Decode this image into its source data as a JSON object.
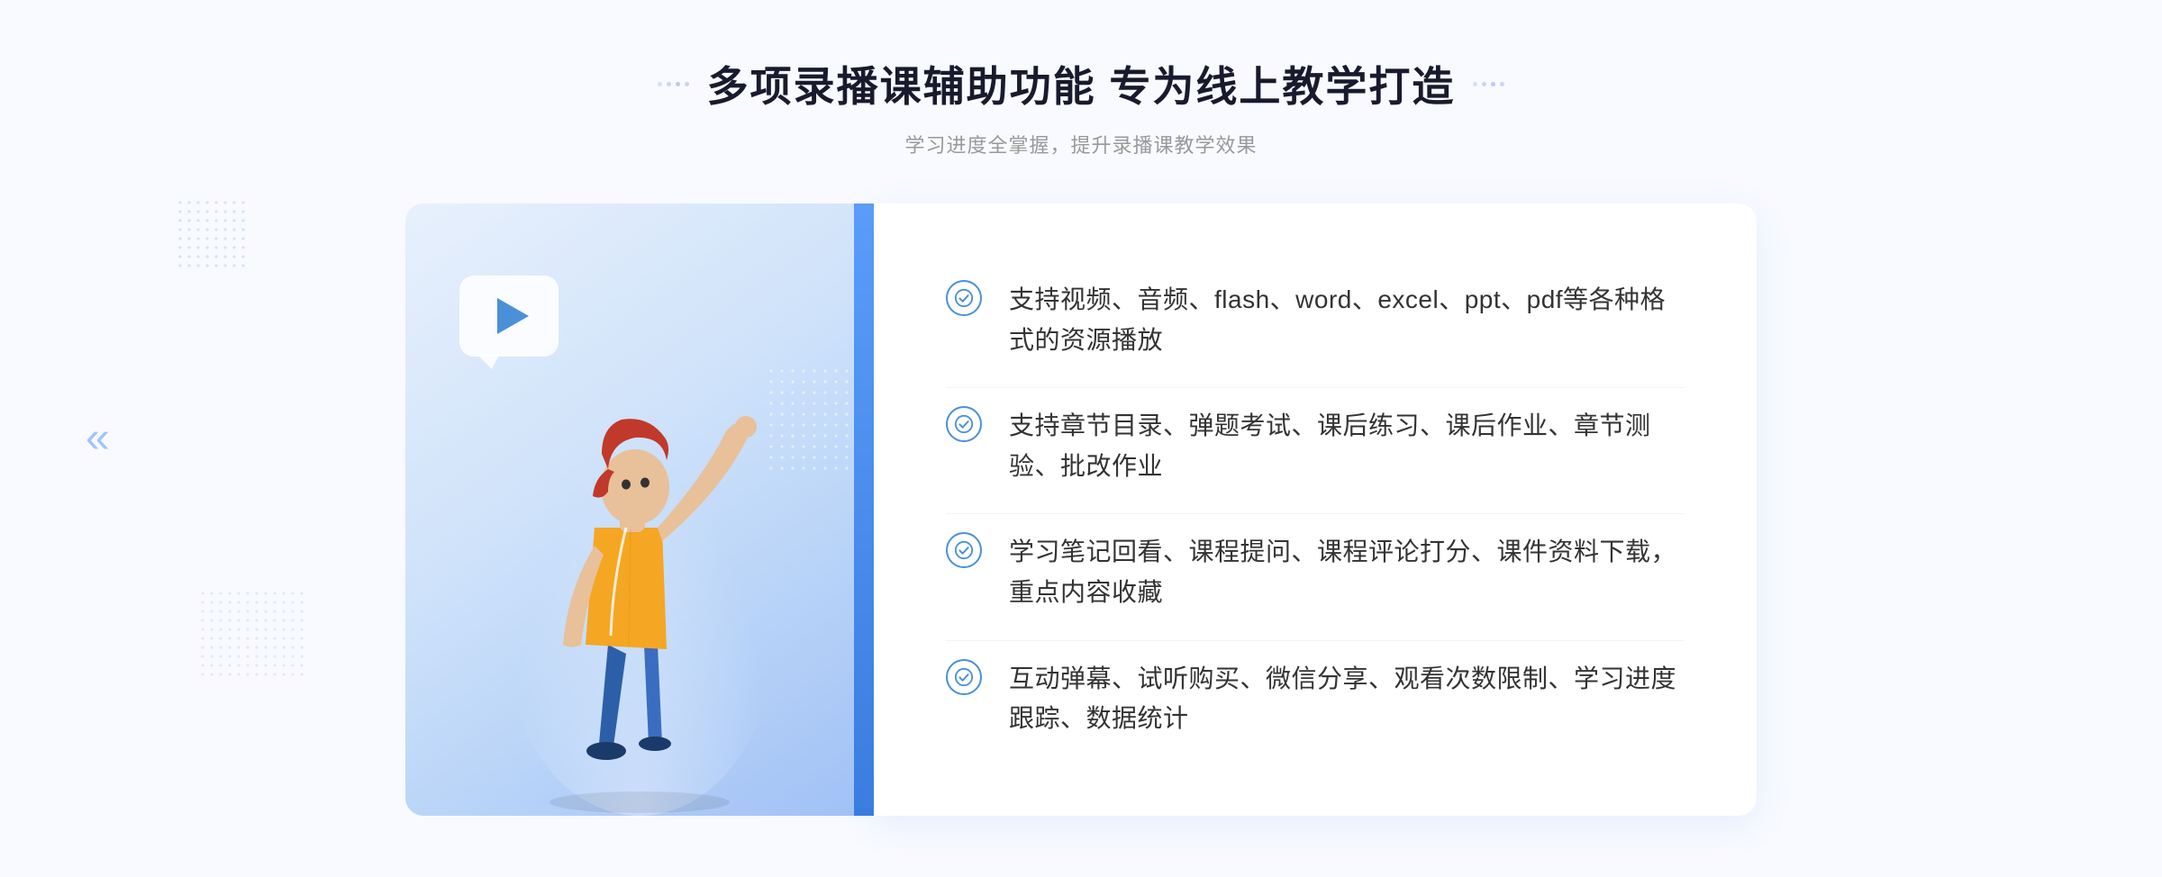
{
  "page": {
    "background_color": "#f8faff"
  },
  "header": {
    "title": "多项录播课辅助功能 专为线上教学打造",
    "subtitle": "学习进度全掌握，提升录播课教学效果"
  },
  "features": [
    {
      "id": "feature-1",
      "text": "支持视频、音频、flash、word、excel、ppt、pdf等各种格式的资源播放"
    },
    {
      "id": "feature-2",
      "text": "支持章节目录、弹题考试、课后练习、课后作业、章节测验、批改作业"
    },
    {
      "id": "feature-3",
      "text": "学习笔记回看、课程提问、课程评论打分、课件资料下载，重点内容收藏"
    },
    {
      "id": "feature-4",
      "text": "互动弹幕、试听购买、微信分享、观看次数限制、学习进度跟踪、数据统计"
    }
  ],
  "decorators": {
    "left_chevron": "«",
    "right_chevron": "»"
  }
}
